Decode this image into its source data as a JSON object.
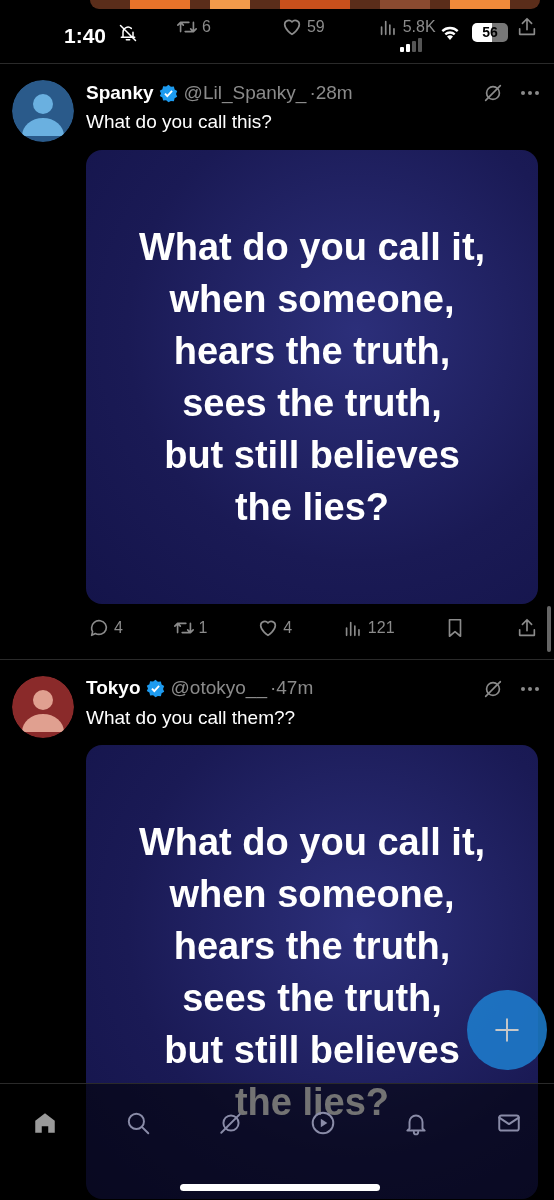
{
  "previous_post": {
    "actions": [
      {
        "kind": "repost",
        "count": "6"
      },
      {
        "kind": "like",
        "count": "59"
      },
      {
        "kind": "views",
        "count": "5.8K"
      },
      {
        "kind": "share"
      }
    ]
  },
  "status_bar": {
    "time": "1:40",
    "silenced": true,
    "battery": "56"
  },
  "posts": [
    {
      "name": "Spanky",
      "verified": true,
      "handle": "@Lil_Spanky_",
      "time": "·28m",
      "text": "What do you call this?",
      "image_lines": [
        "What do you call it,",
        "when someone,",
        "hears the truth,",
        "sees the truth,",
        "but still believes",
        "the lies?"
      ],
      "actions": [
        {
          "kind": "reply",
          "count": "4"
        },
        {
          "kind": "repost",
          "count": "1"
        },
        {
          "kind": "like",
          "count": "4"
        },
        {
          "kind": "views",
          "count": "121"
        },
        {
          "kind": "bookmark"
        },
        {
          "kind": "share"
        }
      ]
    },
    {
      "name": "Tokyo",
      "verified": true,
      "handle": "@otokyo__",
      "time": "·47m",
      "text": "What do you call them??",
      "image_lines": [
        "What do you call it,",
        "when someone,",
        "hears the truth,",
        "sees the truth,",
        "but still believes",
        "the lies?"
      ]
    }
  ],
  "bottom_nav": [
    {
      "kind": "home",
      "selected": true
    },
    {
      "kind": "search",
      "selected": false
    },
    {
      "kind": "grok",
      "selected": false
    },
    {
      "kind": "video",
      "selected": false
    },
    {
      "kind": "notifications",
      "selected": false
    },
    {
      "kind": "messages",
      "selected": false
    }
  ]
}
